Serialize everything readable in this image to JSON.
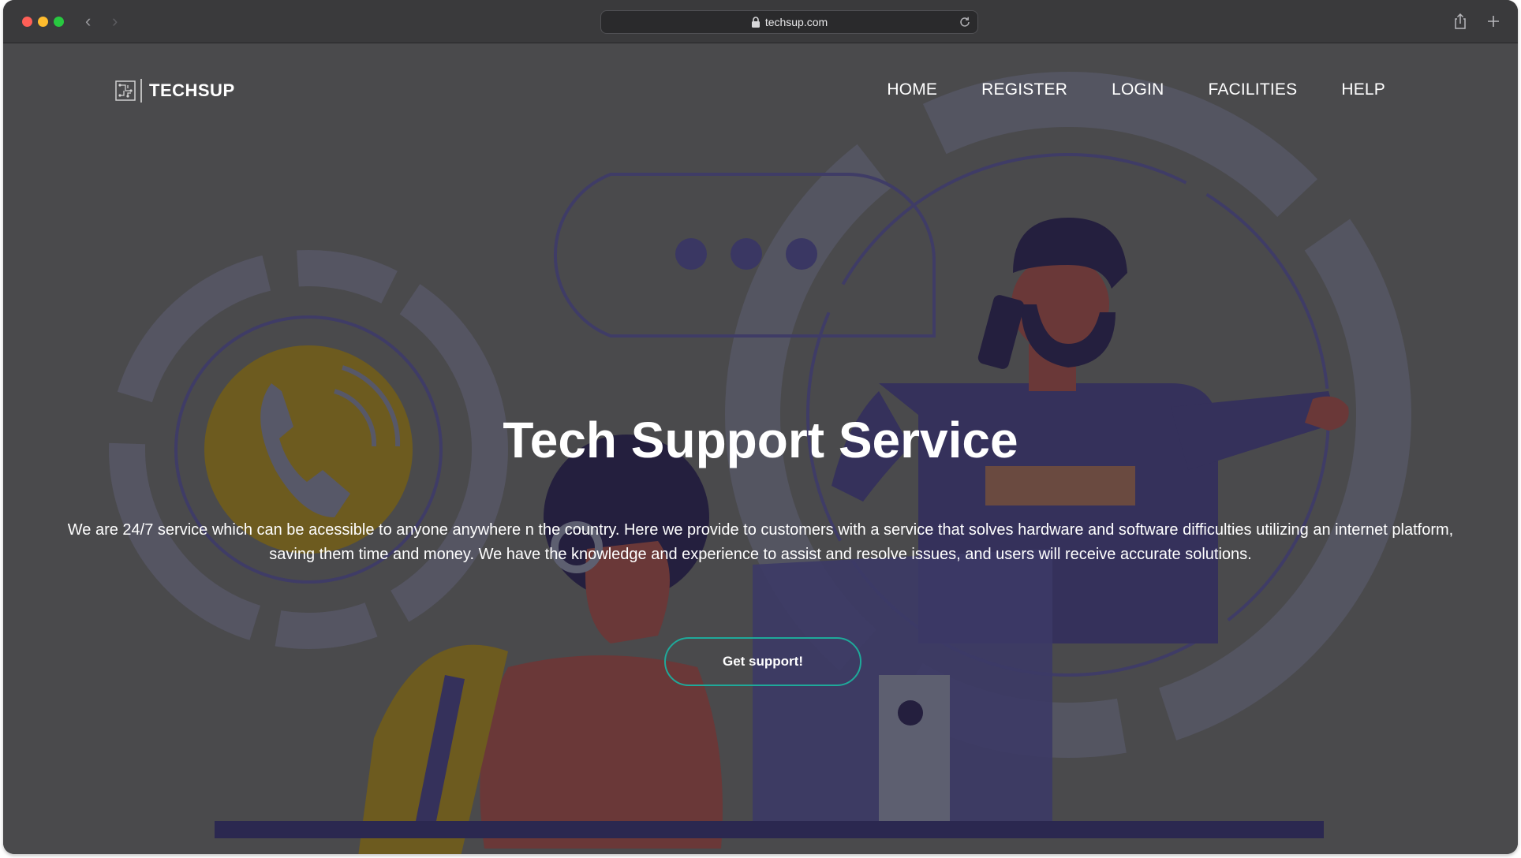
{
  "browser": {
    "url": "techsup.com",
    "icons": [
      "lock-icon",
      "reload-icon",
      "back-arrow-icon",
      "forward-arrow-icon",
      "share-icon",
      "new-tab-icon"
    ]
  },
  "header": {
    "brand_name": "TECHSUP",
    "logo_icon": "circuit-logo-icon",
    "nav": [
      {
        "label": "HOME"
      },
      {
        "label": "REGISTER"
      },
      {
        "label": "LOGIN"
      },
      {
        "label": "FACILITIES"
      },
      {
        "label": "HELP"
      }
    ]
  },
  "hero": {
    "title": "Tech Support Service",
    "description_line1": "We are 24/7 service which can be acessible to anyone anywhere n the country. Here we provide to customers with a service that solves hardware and software difficulties utilizing an internet platform,",
    "description_line2": "saving them time and money. We have the knowledge and experience to assist and resolve issues, and users will receive accurate solutions.",
    "cta_label": "Get support!"
  },
  "colors": {
    "page_bg": "#4a4a4c",
    "accent_border": "#1fa99a",
    "text": "#ffffff",
    "illustration_yellow": "#6f5c1e",
    "illustration_purple": "#34305a",
    "illustration_skin": "#6a3a3a"
  }
}
